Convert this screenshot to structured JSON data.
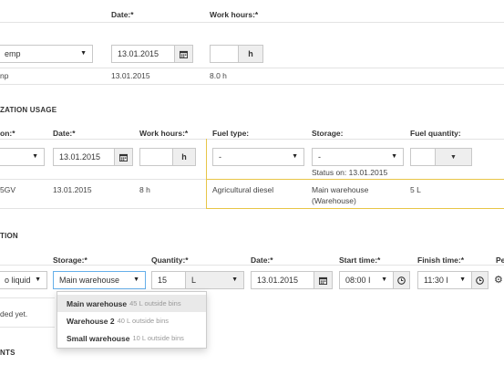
{
  "work": {
    "headers": {
      "date": "Date:*",
      "work_hours": "Work hours:*"
    },
    "form": {
      "select_value": "emp",
      "date_value": "13.01.2015",
      "hours_value": "",
      "hours_unit": "h"
    },
    "row": {
      "name": "np",
      "date": "13.01.2015",
      "hours": "8.0 h"
    }
  },
  "mech": {
    "title": "ZATION USAGE",
    "headers": {
      "machine": "on:*",
      "date": "Date:*",
      "work_hours": "Work hours:*",
      "fuel_type": "Fuel type:",
      "storage": "Storage:",
      "fuel_quantity": "Fuel quantity:"
    },
    "form": {
      "machine_value": "",
      "date_value": "13.01.2015",
      "hours_value": "",
      "hours_unit": "h",
      "fuel_type_value": "-",
      "storage_value": "-",
      "status": "Status on: 13.01.2015",
      "fuel_qty_value": ""
    },
    "row": {
      "machine": "5GV",
      "date": "13.01.2015",
      "hours": "8 h",
      "fuel_type": "Agricultural diesel",
      "storage_line1": "Main warehouse",
      "storage_line2": "(Warehouse)",
      "fuel_qty": "5 L"
    }
  },
  "fert": {
    "title": "TION",
    "headers": {
      "storage": "Storage:*",
      "quantity": "Quantity:*",
      "date": "Date:*",
      "start": "Start time:*",
      "finish": "Finish time:*",
      "extra": "Pe"
    },
    "form": {
      "product_value": "o liquid",
      "storage_value": "Main warehouse",
      "quantity_value": "15",
      "unit_value": "L",
      "date_value": "13.01.2015",
      "start_value": "08:00 I",
      "finish_value": "11:30 I"
    },
    "empty_text": "ded yet.",
    "storage_options": [
      {
        "name": "Main warehouse",
        "note": "45 L outside bins"
      },
      {
        "name": "Warehouse 2",
        "note": "40 L outside bins"
      },
      {
        "name": "Small warehouse",
        "note": "10 L outside bins"
      }
    ]
  },
  "next_section": {
    "title": "NTS"
  },
  "icons": {
    "calendar": "calendar-icon",
    "clock": "clock-icon",
    "gear": "gear-icon",
    "caret": "caret-down-icon"
  }
}
